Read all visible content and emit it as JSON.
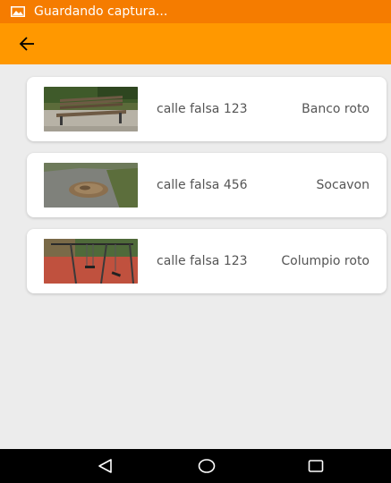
{
  "status_bar": {
    "text": "Guardando captura...",
    "icon": "image-notification-icon"
  },
  "app_bar": {
    "back_icon": "arrow-back-icon"
  },
  "reports": [
    {
      "address": "calle falsa 123",
      "title": "Banco roto",
      "photo": "broken-bench"
    },
    {
      "address": "calle falsa 456",
      "title": "Socavon",
      "photo": "pothole"
    },
    {
      "address": "calle falsa 123",
      "title": "Columpio roto",
      "photo": "broken-swing"
    }
  ],
  "nav_bar": {
    "back": "nav-back-icon",
    "home": "nav-home-icon",
    "recents": "nav-recents-icon"
  },
  "colors": {
    "status_bar": "#f57c00",
    "app_bar": "#ff9800",
    "background": "#ececec",
    "card": "#ffffff",
    "text": "#555555"
  }
}
